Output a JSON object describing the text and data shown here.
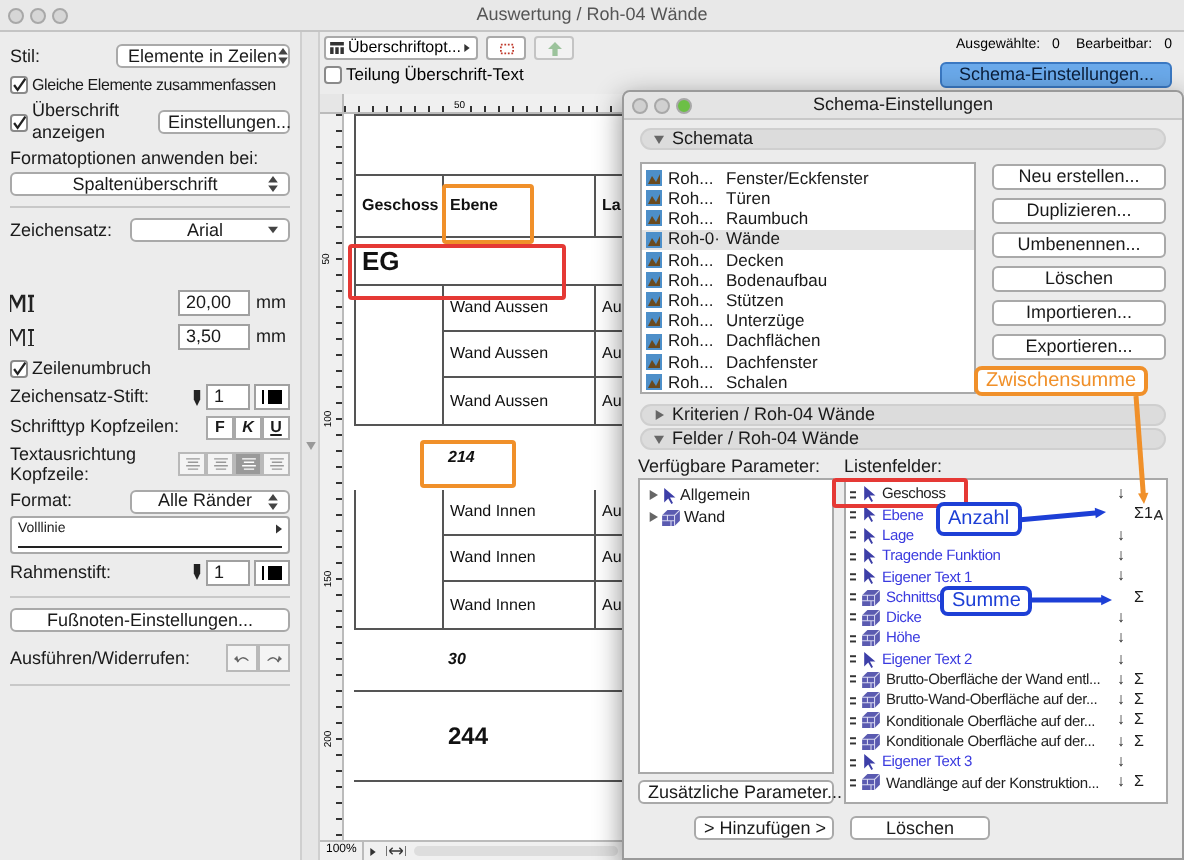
{
  "window": {
    "title": "Auswertung / Roh-04 Wände"
  },
  "left_panel": {
    "style_select": {
      "label": "Stil:",
      "value": "Elemente in Zeilen"
    },
    "merge_checkbox": {
      "label": "Gleiche Elemente zusammenfassen",
      "checked": true
    },
    "header_checkbox": {
      "label": "Überschrift anzeigen",
      "checked": true
    },
    "settings_button": "Einstellungen...",
    "apply_format": {
      "label": "Formatoptionen anwenden bei:",
      "value": "Spaltenüberschrift"
    },
    "font_select": {
      "label": "Zeichensatz:",
      "value": "Arial"
    },
    "size_fields": [
      {
        "value": "20,00",
        "unit": "mm"
      },
      {
        "value": "3,50",
        "unit": "mm"
      }
    ],
    "wrap_checkbox": {
      "label": "Zeilenumbruch",
      "checked": true
    },
    "font_pen": {
      "label": "Zeichensatz-Stift:",
      "value": "1"
    },
    "header_font": {
      "label": "Schrifttyp Kopfzeilen:",
      "buttons": [
        "F",
        "K",
        "U"
      ]
    },
    "header_alignment": {
      "label": "Textausrichtung Kopfzeile:",
      "options": [
        {
          "selected": false
        },
        {
          "selected": false
        },
        {
          "selected": true
        },
        {
          "selected": false
        }
      ]
    },
    "border_format": {
      "label": "Format:",
      "value": "Alle Ränder"
    },
    "line_type": {
      "value": "Volllinie"
    },
    "frame_pen": {
      "label": "Rahmenstift:",
      "value": "1"
    },
    "footnote_button": "Fußnoten-Einstellungen...",
    "undo_redo": {
      "label": "Ausführen/Widerrufen:"
    }
  },
  "toolbar": {
    "header_options_button": "Überschriftopt...",
    "split_checkbox": {
      "label": "Teilung Überschrift-Text",
      "checked": false
    }
  },
  "counters": [
    {
      "label": "Ausgewählte:",
      "value": "0"
    },
    {
      "label": "Bearbeitbar:",
      "value": "0"
    }
  ],
  "schema_button": "Schema-Einstellungen...",
  "ruler": {
    "top_label": "50",
    "side_labels": [
      "50",
      "100",
      "150",
      "200"
    ]
  },
  "document": {
    "columns": [
      "Geschoss",
      "Ebene",
      "La"
    ],
    "group": "EG",
    "sections": [
      {
        "rows": [
          [
            "Wand Aussen",
            "Au"
          ],
          [
            "Wand Aussen",
            "Au"
          ],
          [
            "Wand Aussen",
            "Au"
          ]
        ],
        "subtotal": "214"
      },
      {
        "rows": [
          [
            "Wand Innen",
            "Au"
          ],
          [
            "Wand Innen",
            "Au"
          ],
          [
            "Wand Innen",
            "Au"
          ]
        ],
        "subtotal": "30"
      }
    ],
    "total": "244"
  },
  "zoom": "100%",
  "dialog": {
    "title": "Schema-Einstellungen",
    "schemata": {
      "title": "Schemata",
      "expanded": true,
      "items": [
        {
          "prefix": "Roh...",
          "name": "Fenster/Eckfenster",
          "selected": false
        },
        {
          "prefix": "Roh...",
          "name": "Türen",
          "selected": false
        },
        {
          "prefix": "Roh...",
          "name": "Raumbuch",
          "selected": false
        },
        {
          "prefix": "Roh-0·",
          "name": "Wände",
          "selected": true
        },
        {
          "prefix": "Roh...",
          "name": "Decken",
          "selected": false
        },
        {
          "prefix": "Roh...",
          "name": "Bodenaufbau",
          "selected": false
        },
        {
          "prefix": "Roh...",
          "name": "Stützen",
          "selected": false
        },
        {
          "prefix": "Roh...",
          "name": "Unterzüge",
          "selected": false
        },
        {
          "prefix": "Roh...",
          "name": "Dachflächen",
          "selected": false
        },
        {
          "prefix": "Roh...",
          "name": "Dachfenster",
          "selected": false
        },
        {
          "prefix": "Roh...",
          "name": "Schalen",
          "selected": false
        }
      ],
      "buttons": [
        "Neu erstellen...",
        "Duplizieren...",
        "Umbenennen...",
        "Löschen",
        "Importieren...",
        "Exportieren..."
      ]
    },
    "criteria": {
      "title": "Kriterien / Roh-04 Wände",
      "expanded": false
    },
    "fields": {
      "title": "Felder / Roh-04 Wände",
      "expanded": true,
      "available_label": "Verfügbare Parameter:",
      "available": [
        {
          "kind": "pointer",
          "label": "Allgemein",
          "expanded": false
        },
        {
          "kind": "wall",
          "label": "Wand",
          "expanded": false
        }
      ],
      "extra_button": "Zusätzliche Parameter...",
      "list_label": "Listenfelder:",
      "list": [
        {
          "kind": "pointer",
          "name": "Geschoss",
          "color": "#222222",
          "sort": "↓"
        },
        {
          "kind": "pointer",
          "name": "Ebene",
          "color": "#3a3adf",
          "total": "Σ1",
          "format_icon": true
        },
        {
          "kind": "pointer",
          "name": "Lage",
          "color": "#3a3adf",
          "sort": "↓"
        },
        {
          "kind": "pointer",
          "name": "Tragende Funktion",
          "color": "#3a3adf",
          "sort": "↓"
        },
        {
          "kind": "pointer",
          "name": "Eigener Text 1",
          "color": "#3a3adf",
          "sort": "↓"
        },
        {
          "kind": "wall",
          "name": "Schnittsc",
          "color": "#3a3adf",
          "total": "Σ"
        },
        {
          "kind": "wall",
          "name": "Dicke",
          "color": "#3a3adf",
          "sort": "↓"
        },
        {
          "kind": "wall",
          "name": "Höhe",
          "color": "#3a3adf",
          "sort": "↓"
        },
        {
          "kind": "pointer",
          "name": "Eigener Text  2",
          "color": "#3a3adf",
          "sort": "↓"
        },
        {
          "kind": "wall",
          "name": "Brutto-Oberfläche der Wand entl...",
          "color": "#222222",
          "sort": "↓",
          "total": "Σ"
        },
        {
          "kind": "wall",
          "name": "Brutto-Wand-Oberfläche auf der...",
          "color": "#222222",
          "sort": "↓",
          "total": "Σ"
        },
        {
          "kind": "wall",
          "name": "Konditionale Oberfläche auf der...",
          "color": "#222222",
          "sort": "↓",
          "total": "Σ"
        },
        {
          "kind": "wall",
          "name": "Konditionale Oberfläche auf der...",
          "color": "#222222",
          "sort": "↓",
          "total": "Σ"
        },
        {
          "kind": "pointer",
          "name": "Eigener Text  3",
          "color": "#3a3adf",
          "sort": "↓"
        },
        {
          "kind": "wall",
          "name": "Wandlänge auf der Konstruktion...",
          "color": "#222222",
          "sort": "↓",
          "total": "Σ"
        }
      ],
      "add_button": "> Hinzufügen >",
      "remove_button": "Löschen"
    }
  },
  "annotations": {
    "frames": [
      {
        "color": "#e53935"
      },
      {
        "color": "#f0902a"
      },
      {
        "color": "#f0902a"
      },
      {
        "color": "#e53935"
      }
    ],
    "callouts": [
      {
        "text": "Zwischensumme",
        "color": "#f0902a"
      },
      {
        "text": "Anzahl",
        "color": "#1d3fd6"
      },
      {
        "text": "Summe",
        "color": "#1d3fd6"
      }
    ]
  }
}
